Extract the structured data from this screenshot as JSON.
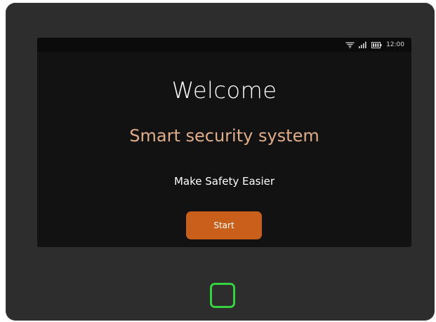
{
  "status_bar": {
    "icons": [
      "wifi-icon",
      "signal-icon",
      "battery-icon"
    ],
    "time": "12:00"
  },
  "main": {
    "title": "Welcome",
    "subtitle": "Smart security system",
    "tagline": "Make Safety Easier",
    "start_label": "Start"
  },
  "device": {
    "indicator_icon": "rounded-square-indicator-icon"
  },
  "colors": {
    "bezel": "#2d2d2d",
    "screen_bg": "#121212",
    "accent": "#c8601c",
    "subtitle_text": "#e0ad8a",
    "indicator": "#37d23f"
  }
}
